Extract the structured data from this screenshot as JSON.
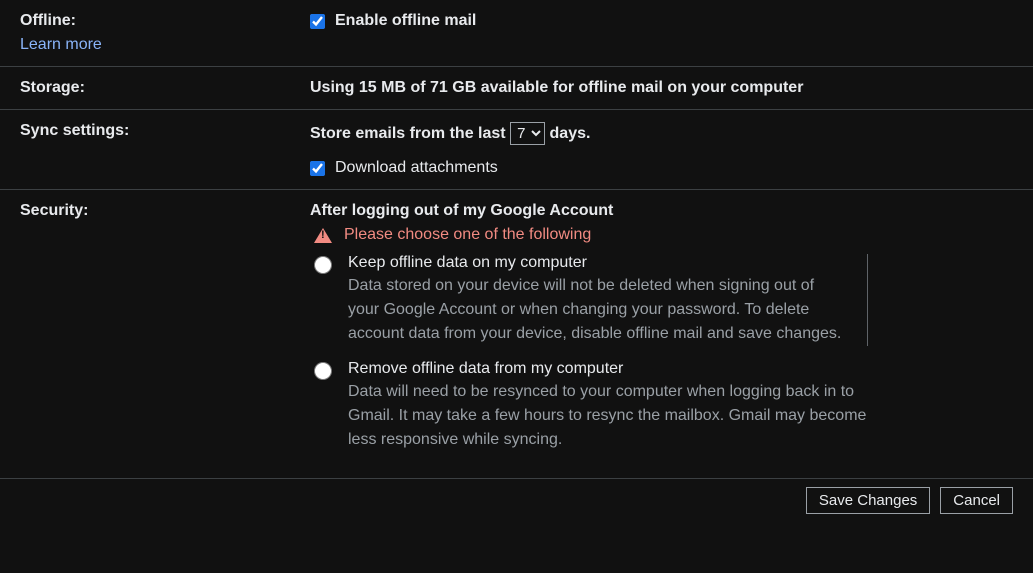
{
  "offline": {
    "label": "Offline:",
    "learn_more": "Learn more",
    "checkbox_label": "Enable offline mail",
    "checked": true
  },
  "storage": {
    "label": "Storage:",
    "value": "Using 15 MB of 71 GB available for offline mail on your computer"
  },
  "sync": {
    "label": "Sync settings:",
    "prefix": "Store emails from the last",
    "selected": "7",
    "suffix": "days.",
    "attachments_label": "Download attachments",
    "attachments_checked": true
  },
  "security": {
    "label": "Security:",
    "header": "After logging out of my Google Account",
    "warning": "Please choose one of the following",
    "options": [
      {
        "title": "Keep offline data on my computer",
        "desc": "Data stored on your device will not be deleted when signing out of your Google Account or when changing your password. To delete account data from your device, disable offline mail and save changes."
      },
      {
        "title": "Remove offline data from my computer",
        "desc": "Data will need to be resynced to your computer when logging back in to Gmail. It may take a few hours to resync the mailbox. Gmail may become less responsive while syncing."
      }
    ]
  },
  "footer": {
    "save": "Save Changes",
    "cancel": "Cancel"
  }
}
